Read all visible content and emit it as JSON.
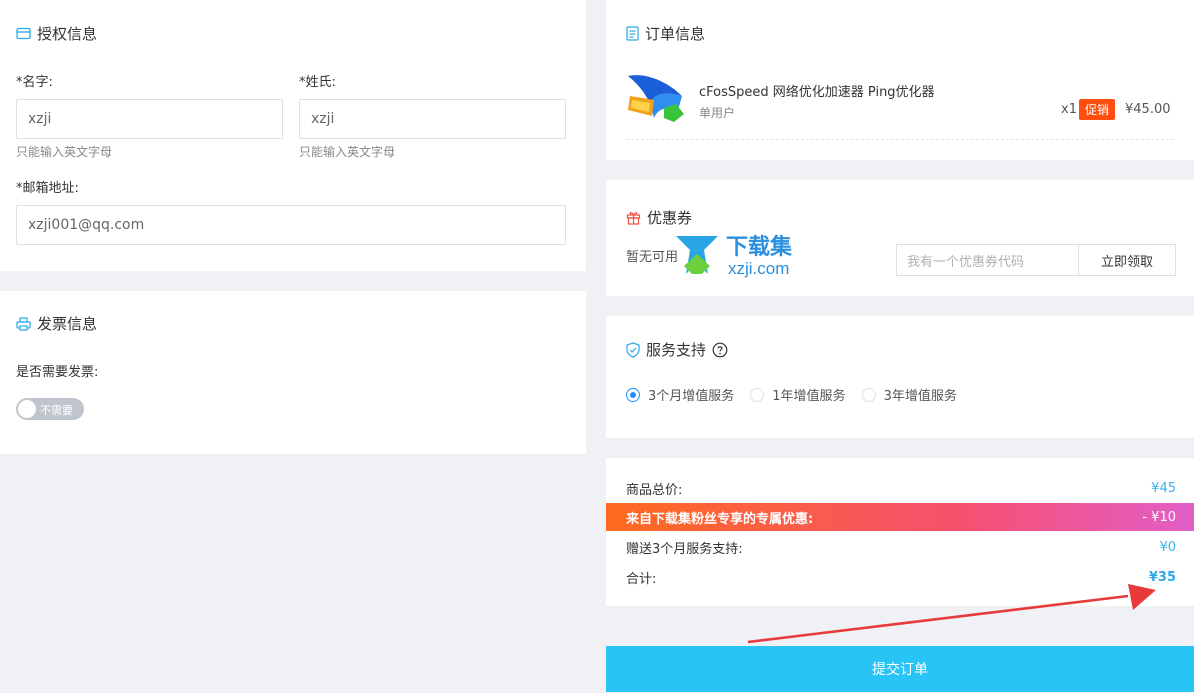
{
  "auth": {
    "title": "授权信息",
    "first_name_label": "*名字:",
    "first_name_value": "xzji",
    "first_name_hint": "只能输入英文字母",
    "last_name_label": "*姓氏:",
    "last_name_value": "xzji",
    "last_name_hint": "只能输入英文字母",
    "email_label": "*邮箱地址:",
    "email_value": "xzji001@qq.com"
  },
  "invoice": {
    "title": "发票信息",
    "question": "是否需要发票:",
    "toggle_text": "不需要",
    "toggle_on": false
  },
  "order": {
    "title": "订单信息",
    "product_name": "cFosSpeed 网络优化加速器 Ping优化器",
    "product_sub": "单用户",
    "qty": "x1",
    "badge": "促销",
    "price": "¥45.00"
  },
  "coupon": {
    "title": "优惠券",
    "none_text": "暂无可用",
    "placeholder": "我有一个优惠券代码",
    "button": "立即领取"
  },
  "watermark": {
    "text_cn": "下载集",
    "text_en": "xzji.com"
  },
  "service": {
    "title": "服务支持",
    "options": [
      {
        "label": "3个月增值服务",
        "checked": true
      },
      {
        "label": "1年增值服务",
        "checked": false
      },
      {
        "label": "3年增值服务",
        "checked": false
      }
    ]
  },
  "summary": {
    "total_price_label": "商品总价:",
    "total_price_value": "¥45",
    "discount_label": "来自下载集粉丝专享的专属优惠:",
    "discount_value": "- ¥10",
    "gift_label": "赠送3个月服务支持:",
    "gift_value": "¥0",
    "sum_label": "合计:",
    "sum_value": "¥35"
  },
  "submit": {
    "label": "提交订单"
  },
  "colors": {
    "accent": "#29c4f6",
    "promo": "#ff4d10",
    "price_blue": "#35b4f0",
    "arrow_red": "#e83a3a"
  }
}
